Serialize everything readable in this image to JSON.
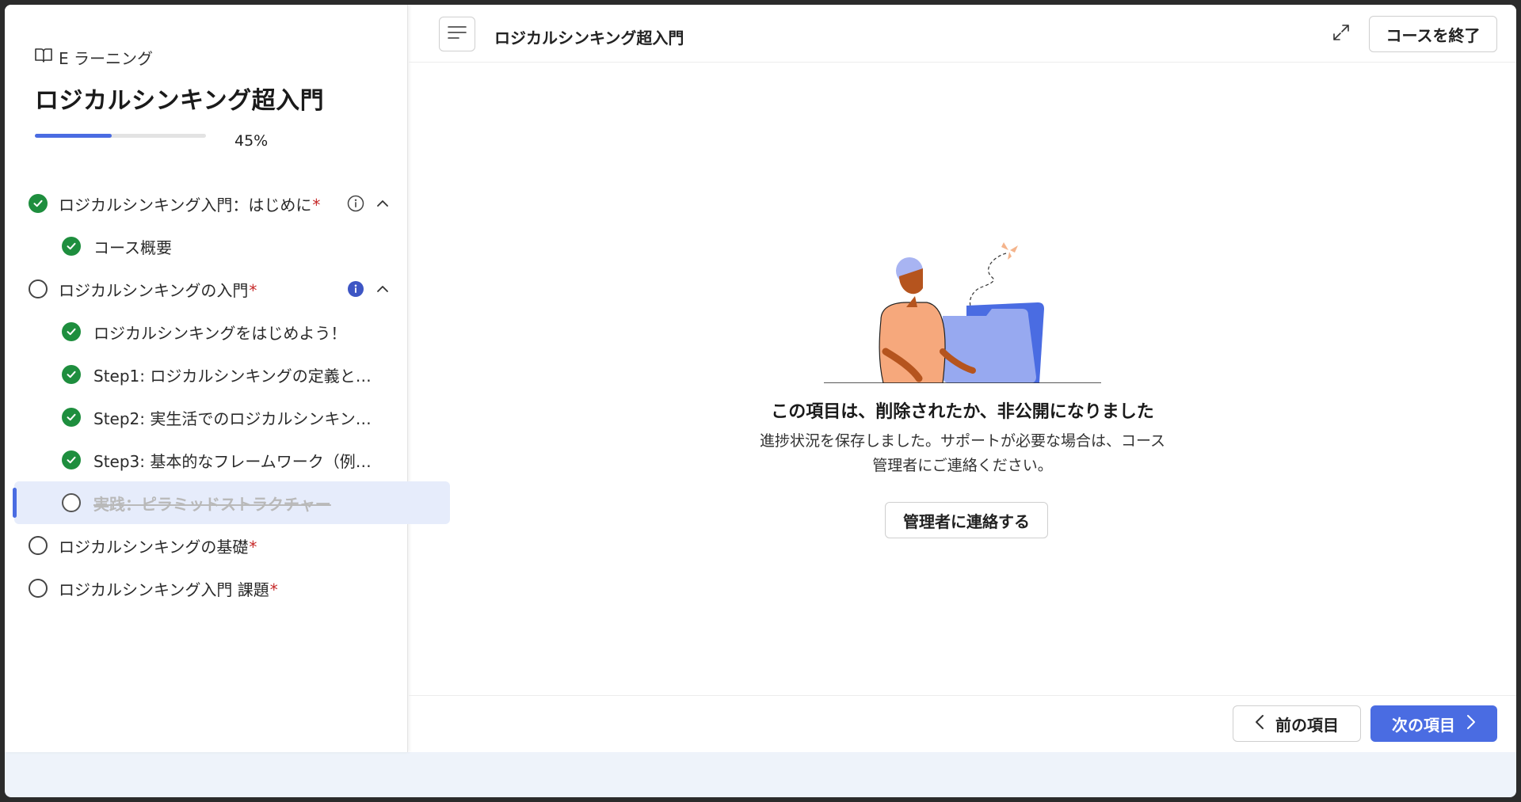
{
  "sidebar": {
    "brand_label": "E ラーニング",
    "course_title": "ロジカルシンキング超入門",
    "progress_percent": 45,
    "progress_text": "45%",
    "items": [
      {
        "label": "ロジカルシンキング入門：はじめに",
        "required": "*",
        "status": "complete",
        "info": "outline",
        "expanded": true
      },
      {
        "label": "コース概要",
        "status": "complete"
      },
      {
        "label": "ロジカルシンキングの入門",
        "required": "*",
        "status": "incomplete",
        "info": "filled",
        "expanded": true
      },
      {
        "label": "ロジカルシンキングをはじめよう！",
        "status": "complete"
      },
      {
        "label": "Step1: ロジカルシンキングの定義と…",
        "status": "complete"
      },
      {
        "label": "Step2: 実生活でのロジカルシンキン…",
        "status": "complete"
      },
      {
        "label": "Step3: 基本的なフレームワーク（例…",
        "status": "complete"
      },
      {
        "label": "実践：ピラミッドストラクチャー",
        "status": "incomplete",
        "selected": true
      },
      {
        "label": "ロジカルシンキングの基礎",
        "required": "*",
        "status": "incomplete"
      },
      {
        "label": "ロジカルシンキング入門 課題",
        "required": "*",
        "status": "incomplete"
      }
    ]
  },
  "header": {
    "title": "ロジカルシンキング超入門",
    "exit_label": "コースを終了"
  },
  "main": {
    "message_title": "この項目は、削除されたか、非公開になりました",
    "message_body": "進捗状況を保存しました。サポートが必要な場合は、コース管理者にご連絡ください。",
    "contact_label": "管理者に連絡する"
  },
  "footer": {
    "prev_label": "前の項目",
    "next_label": "次の項目"
  },
  "icons": {
    "brand": "book-open-icon",
    "menu": "menu-lines-icon",
    "expand": "expand-arrows-icon",
    "complete": "check-circle-icon",
    "incomplete": "empty-circle-icon",
    "info": "info-icon",
    "collapse": "chevron-up-icon",
    "prev": "chevron-left-icon",
    "next": "chevron-right-icon"
  },
  "colors": {
    "accent": "#4a6ce2",
    "complete": "#1e8e3e",
    "required": "#c62828",
    "selected_bg": "#e6ecfb"
  }
}
